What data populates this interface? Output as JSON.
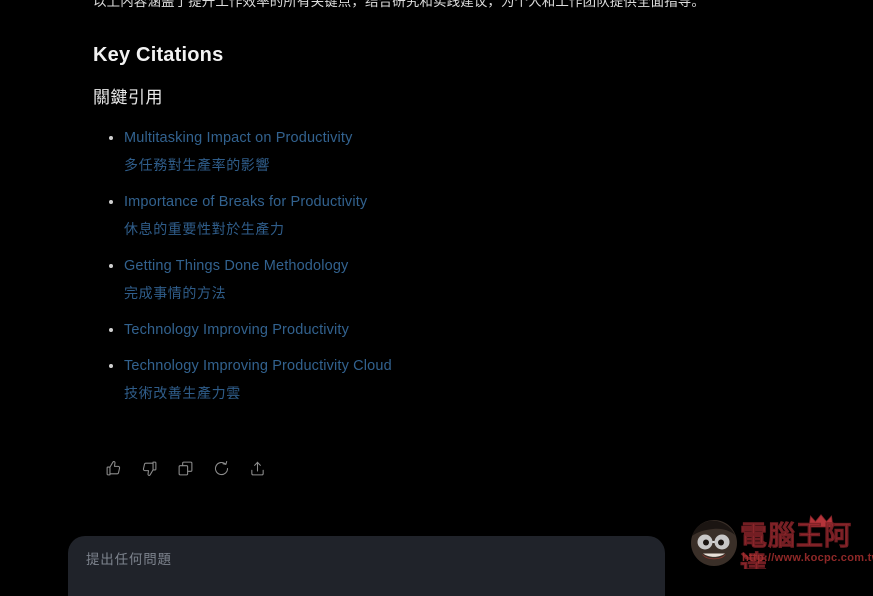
{
  "answer": {
    "intro_line": "以上内容涵盖了提升工作效率的所有关键点，结合研究和实践建议，为个人和工作团队提供全面指导。",
    "section_title": "Key Citations",
    "section_title_cn": "關鍵引用",
    "citations": [
      {
        "title": "Multitasking Impact on Productivity",
        "subtitle": "多任務對生產率的影響"
      },
      {
        "title": "Importance of Breaks for Productivity",
        "subtitle": "休息的重要性對於生產力"
      },
      {
        "title": "Getting Things Done Methodology",
        "subtitle": "完成事情的方法"
      },
      {
        "title": "Technology Improving Productivity",
        "subtitle": ""
      },
      {
        "title": "Technology Improving Productivity Cloud",
        "subtitle": "技術改善生產力雲"
      }
    ]
  },
  "action_bar": {
    "buttons": [
      {
        "name": "thumbs-up-icon",
        "label": "Like"
      },
      {
        "name": "thumbs-down-icon",
        "label": "Dislike"
      },
      {
        "name": "copy-icon",
        "label": "Copy"
      },
      {
        "name": "regenerate-icon",
        "label": "Regenerate"
      },
      {
        "name": "share-icon",
        "label": "Share"
      }
    ]
  },
  "composer": {
    "placeholder": "提出任何問題",
    "value": ""
  },
  "watermark": {
    "brand": "電腦王阿達",
    "url": "http://www.kocpc.com.tw"
  },
  "colors": {
    "background": "#000000",
    "link": "#32628f",
    "link_cn": "#2f5d8a",
    "heading": "#f2f2f2",
    "body_text": "#dcdcdc",
    "icon_stroke": "#8d8d8d",
    "composer_bg": "#20232a",
    "composer_placeholder": "#7d838d",
    "watermark_red": "#b5343a"
  }
}
